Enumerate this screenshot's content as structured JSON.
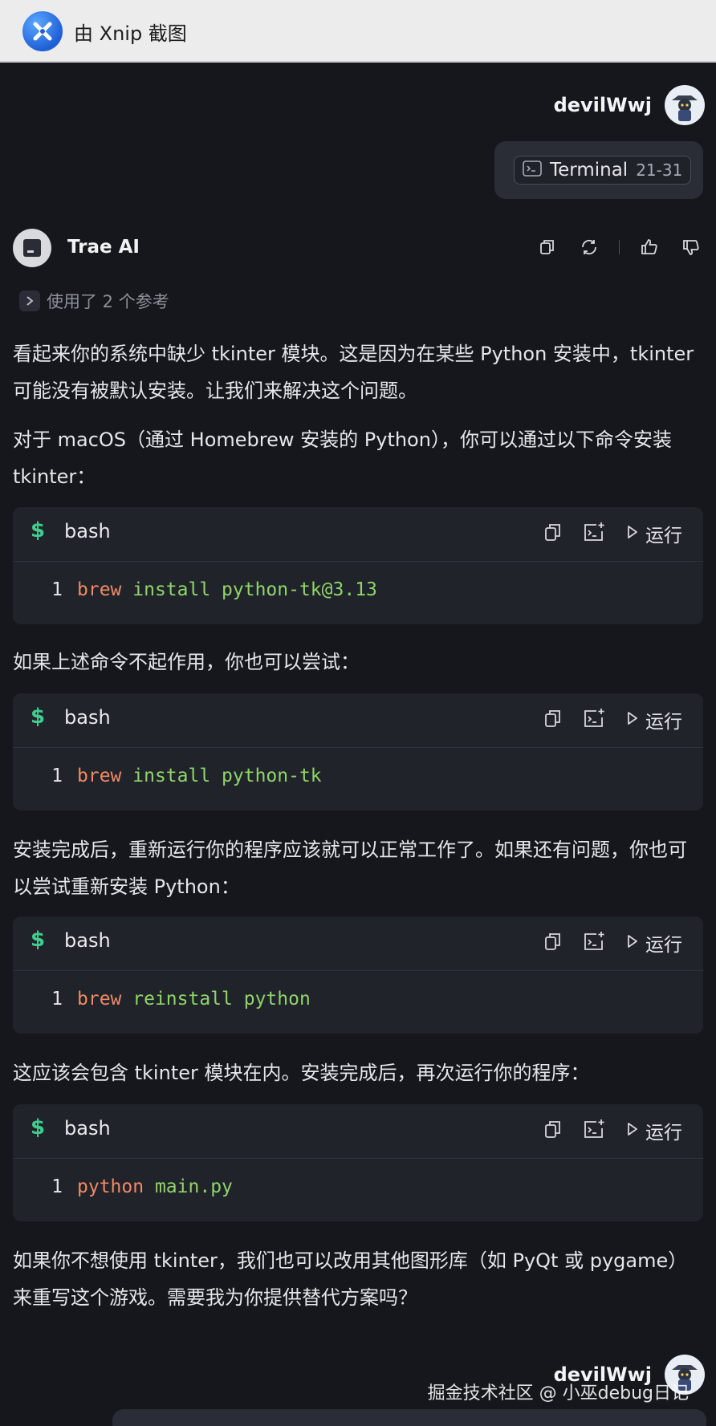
{
  "titlebar": {
    "title": "由 Xnip 截图"
  },
  "user": {
    "name": "devilWwj"
  },
  "context": {
    "label": "Terminal",
    "range": "21-31"
  },
  "assistant": {
    "name": "Trae AI",
    "refs": "使用了 2 个参考",
    "actions": [
      "copy-icon",
      "refresh-icon",
      "thumbs-up-icon",
      "thumbs-down-icon"
    ]
  },
  "paragraphs": [
    "看起来你的系统中缺少 tkinter 模块。这是因为在某些 Python 安装中，tkinter 可能没有被默认安装。让我们来解决这个问题。",
    "对于 macOS（通过 Homebrew 安装的 Python），你可以通过以下命令安装 tkinter：",
    "如果上述命令不起作用，你也可以尝试：",
    "安装完成后，重新运行你的程序应该就可以正常工作了。如果还有问题，你也可以尝试重新安装 Python：",
    "这应该会包含 tkinter 模块在内。安装完成后，再次运行你的程序：",
    "如果你不想使用 tkinter，我们也可以改用其他图形库（如 PyQt 或 pygame）来重写这个游戏。需要我为你提供替代方案吗？"
  ],
  "code_blocks": [
    {
      "prompt": "$",
      "lang": "bash",
      "run": "运行",
      "line_no": "1",
      "cmd": "brew",
      "args": "install python-tk@3.13"
    },
    {
      "prompt": "$",
      "lang": "bash",
      "run": "运行",
      "line_no": "1",
      "cmd": "brew",
      "args": "install python-tk"
    },
    {
      "prompt": "$",
      "lang": "bash",
      "run": "运行",
      "line_no": "1",
      "cmd": "brew",
      "args": "reinstall python"
    },
    {
      "prompt": "$",
      "lang": "bash",
      "run": "运行",
      "line_no": "1",
      "cmd": "python",
      "args": "main.py"
    }
  ],
  "footer": {
    "user_name": "devilWwj",
    "watermark": "掘金技术社区 @ 小巫debug日记"
  },
  "colors": {
    "accent_green": "#3ccf8e",
    "keyword": "#f08a63",
    "argument": "#8fd46a",
    "background": "#15171c"
  }
}
